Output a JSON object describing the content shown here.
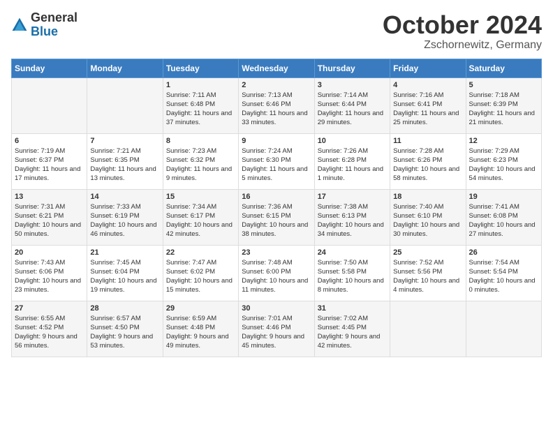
{
  "header": {
    "logo_general": "General",
    "logo_blue": "Blue",
    "month_title": "October 2024",
    "location": "Zschornewitz, Germany"
  },
  "days_of_week": [
    "Sunday",
    "Monday",
    "Tuesday",
    "Wednesday",
    "Thursday",
    "Friday",
    "Saturday"
  ],
  "weeks": [
    [
      {
        "day": "",
        "content": ""
      },
      {
        "day": "",
        "content": ""
      },
      {
        "day": "1",
        "content": "Sunrise: 7:11 AM\nSunset: 6:48 PM\nDaylight: 11 hours and 37 minutes."
      },
      {
        "day": "2",
        "content": "Sunrise: 7:13 AM\nSunset: 6:46 PM\nDaylight: 11 hours and 33 minutes."
      },
      {
        "day": "3",
        "content": "Sunrise: 7:14 AM\nSunset: 6:44 PM\nDaylight: 11 hours and 29 minutes."
      },
      {
        "day": "4",
        "content": "Sunrise: 7:16 AM\nSunset: 6:41 PM\nDaylight: 11 hours and 25 minutes."
      },
      {
        "day": "5",
        "content": "Sunrise: 7:18 AM\nSunset: 6:39 PM\nDaylight: 11 hours and 21 minutes."
      }
    ],
    [
      {
        "day": "6",
        "content": "Sunrise: 7:19 AM\nSunset: 6:37 PM\nDaylight: 11 hours and 17 minutes."
      },
      {
        "day": "7",
        "content": "Sunrise: 7:21 AM\nSunset: 6:35 PM\nDaylight: 11 hours and 13 minutes."
      },
      {
        "day": "8",
        "content": "Sunrise: 7:23 AM\nSunset: 6:32 PM\nDaylight: 11 hours and 9 minutes."
      },
      {
        "day": "9",
        "content": "Sunrise: 7:24 AM\nSunset: 6:30 PM\nDaylight: 11 hours and 5 minutes."
      },
      {
        "day": "10",
        "content": "Sunrise: 7:26 AM\nSunset: 6:28 PM\nDaylight: 11 hours and 1 minute."
      },
      {
        "day": "11",
        "content": "Sunrise: 7:28 AM\nSunset: 6:26 PM\nDaylight: 10 hours and 58 minutes."
      },
      {
        "day": "12",
        "content": "Sunrise: 7:29 AM\nSunset: 6:23 PM\nDaylight: 10 hours and 54 minutes."
      }
    ],
    [
      {
        "day": "13",
        "content": "Sunrise: 7:31 AM\nSunset: 6:21 PM\nDaylight: 10 hours and 50 minutes."
      },
      {
        "day": "14",
        "content": "Sunrise: 7:33 AM\nSunset: 6:19 PM\nDaylight: 10 hours and 46 minutes."
      },
      {
        "day": "15",
        "content": "Sunrise: 7:34 AM\nSunset: 6:17 PM\nDaylight: 10 hours and 42 minutes."
      },
      {
        "day": "16",
        "content": "Sunrise: 7:36 AM\nSunset: 6:15 PM\nDaylight: 10 hours and 38 minutes."
      },
      {
        "day": "17",
        "content": "Sunrise: 7:38 AM\nSunset: 6:13 PM\nDaylight: 10 hours and 34 minutes."
      },
      {
        "day": "18",
        "content": "Sunrise: 7:40 AM\nSunset: 6:10 PM\nDaylight: 10 hours and 30 minutes."
      },
      {
        "day": "19",
        "content": "Sunrise: 7:41 AM\nSunset: 6:08 PM\nDaylight: 10 hours and 27 minutes."
      }
    ],
    [
      {
        "day": "20",
        "content": "Sunrise: 7:43 AM\nSunset: 6:06 PM\nDaylight: 10 hours and 23 minutes."
      },
      {
        "day": "21",
        "content": "Sunrise: 7:45 AM\nSunset: 6:04 PM\nDaylight: 10 hours and 19 minutes."
      },
      {
        "day": "22",
        "content": "Sunrise: 7:47 AM\nSunset: 6:02 PM\nDaylight: 10 hours and 15 minutes."
      },
      {
        "day": "23",
        "content": "Sunrise: 7:48 AM\nSunset: 6:00 PM\nDaylight: 10 hours and 11 minutes."
      },
      {
        "day": "24",
        "content": "Sunrise: 7:50 AM\nSunset: 5:58 PM\nDaylight: 10 hours and 8 minutes."
      },
      {
        "day": "25",
        "content": "Sunrise: 7:52 AM\nSunset: 5:56 PM\nDaylight: 10 hours and 4 minutes."
      },
      {
        "day": "26",
        "content": "Sunrise: 7:54 AM\nSunset: 5:54 PM\nDaylight: 10 hours and 0 minutes."
      }
    ],
    [
      {
        "day": "27",
        "content": "Sunrise: 6:55 AM\nSunset: 4:52 PM\nDaylight: 9 hours and 56 minutes."
      },
      {
        "day": "28",
        "content": "Sunrise: 6:57 AM\nSunset: 4:50 PM\nDaylight: 9 hours and 53 minutes."
      },
      {
        "day": "29",
        "content": "Sunrise: 6:59 AM\nSunset: 4:48 PM\nDaylight: 9 hours and 49 minutes."
      },
      {
        "day": "30",
        "content": "Sunrise: 7:01 AM\nSunset: 4:46 PM\nDaylight: 9 hours and 45 minutes."
      },
      {
        "day": "31",
        "content": "Sunrise: 7:02 AM\nSunset: 4:45 PM\nDaylight: 9 hours and 42 minutes."
      },
      {
        "day": "",
        "content": ""
      },
      {
        "day": "",
        "content": ""
      }
    ]
  ]
}
